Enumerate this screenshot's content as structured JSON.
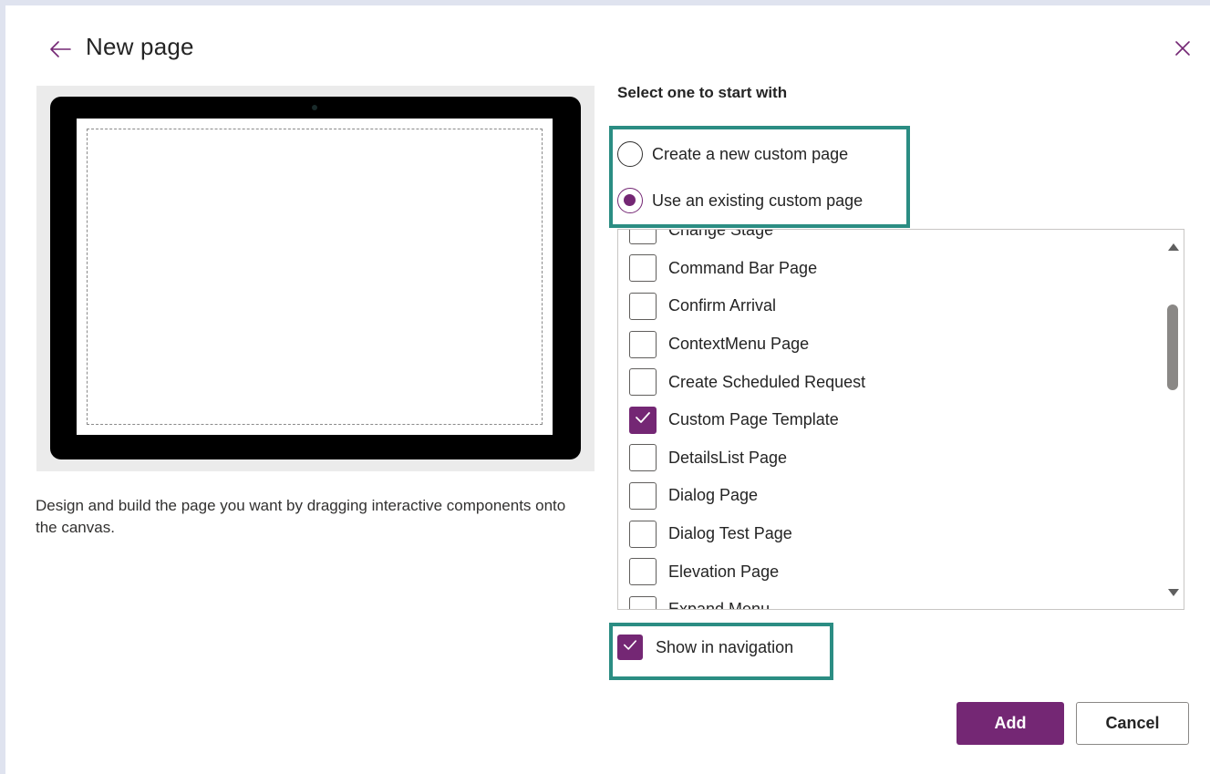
{
  "dialog": {
    "title": "New page",
    "back_icon": "arrow-left-icon",
    "close_icon": "close-icon"
  },
  "preview": {
    "description": "Design and build the page you want by dragging interactive components onto the canvas."
  },
  "options": {
    "heading": "Select one to start with",
    "radios": [
      {
        "label": "Create a new custom page",
        "checked": false
      },
      {
        "label": "Use an existing custom page",
        "checked": true
      }
    ]
  },
  "page_list": {
    "items": [
      {
        "label": "Change Stage",
        "checked": false
      },
      {
        "label": "Command Bar Page",
        "checked": false
      },
      {
        "label": "Confirm Arrival",
        "checked": false
      },
      {
        "label": "ContextMenu Page",
        "checked": false
      },
      {
        "label": "Create Scheduled Request",
        "checked": false
      },
      {
        "label": "Custom Page Template",
        "checked": true
      },
      {
        "label": "DetailsList Page",
        "checked": false
      },
      {
        "label": "Dialog Page",
        "checked": false
      },
      {
        "label": "Dialog Test Page",
        "checked": false
      },
      {
        "label": "Elevation Page",
        "checked": false
      },
      {
        "label": "Expand Menu",
        "checked": false
      }
    ]
  },
  "navigation": {
    "label": "Show in navigation",
    "checked": true
  },
  "footer": {
    "add_label": "Add",
    "cancel_label": "Cancel"
  },
  "colors": {
    "accent": "#742774",
    "highlight": "#2b8d83"
  }
}
